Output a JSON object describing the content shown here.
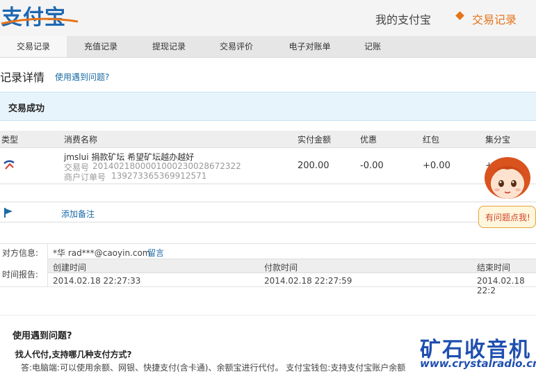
{
  "header": {
    "logo_text": "支付宝",
    "nav_my": "我的支付宝",
    "nav_trade": "交易记录"
  },
  "tabs": [
    "交易记录",
    "充值记录",
    "提现记录",
    "交易评价",
    "电子对账单",
    "记账"
  ],
  "page": {
    "title": "记录详情",
    "help_link": "使用遇到问题?",
    "status": "交易成功"
  },
  "table": {
    "headers": [
      "类型",
      "消费名称",
      "实付金额",
      "优惠",
      "红包",
      "集分宝"
    ],
    "row": {
      "name": "jmslui 捐款矿坛 希望矿坛越办越好",
      "trade_no_label": "交易号",
      "trade_no": "2014021800001000230028672322",
      "order_no_label": "商户订单号",
      "order_no": "139273365369912571",
      "amount": "200.00",
      "discount": "-0.00",
      "red_packet": "+0.00",
      "jifenbao": "+"
    },
    "add_note": "添加备注"
  },
  "counterparty": {
    "label": "对方信息:",
    "name": "*华 rad***@caoyin.com",
    "message_link": "留言"
  },
  "time_report": {
    "label": "时间报告:",
    "columns": [
      "创建时间",
      "付款时间",
      "结束时间"
    ],
    "values": [
      "2014.02.18 22:27:33",
      "2014.02.18 22:27:59",
      "2014.02.18 22:2"
    ]
  },
  "faq": {
    "title": "使用遇到问题?",
    "question": "找人代付,支持哪几种支付方式?",
    "answer": "答:电脑端:可以使用余额、网银、快捷支付(含卡通)、余额宝进行代付。 支付宝钱包:支持支付宝账户余额"
  },
  "mascot": {
    "bubble_text": "有问题点我!"
  },
  "watermark": {
    "title": "矿石收音机",
    "url": "www.crystalradio.cn"
  },
  "colors": {
    "accent_orange": "#e6741a",
    "link_blue": "#1b6aa5",
    "status_bg": "#e8f4fc"
  }
}
